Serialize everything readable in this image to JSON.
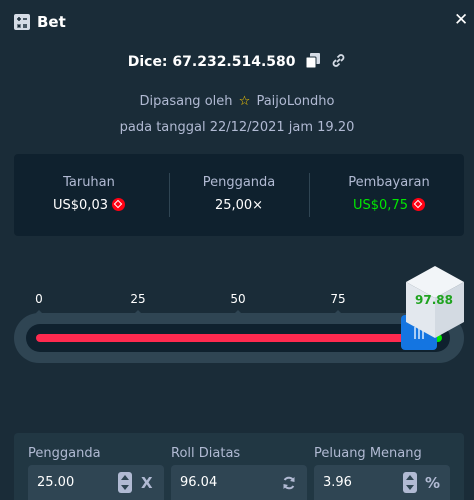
{
  "header": {
    "title": "Bet",
    "close": "✕"
  },
  "bet": {
    "dice_label": "Dice: 67.232.514.580",
    "placed_prefix": "Dipasang oleh",
    "player": "PaijoLondho",
    "date_line": "pada tanggal 22/12/2021 jam 19.20"
  },
  "stats": {
    "wager_label": "Taruhan",
    "wager_value": "US$0,03",
    "multiplier_label": "Pengganda",
    "multiplier_value": "25,00×",
    "payout_label": "Pembayaran",
    "payout_value": "US$0,75",
    "payout_color": "#00e701",
    "currency_icon": "tron-icon"
  },
  "slider": {
    "ticks": [
      "0",
      "25",
      "50",
      "75"
    ],
    "roll_over": 96.04,
    "result": "97.88",
    "lose_color": "#ff2a4f",
    "win_color": "#00e701",
    "handle_color": "#1475e1"
  },
  "fields": {
    "multiplier_label": "Pengganda",
    "multiplier_value": "25.00",
    "multiplier_suffix": "X",
    "roll_label": "Roll Diatas",
    "roll_value": "96.04",
    "chance_label": "Peluang Menang",
    "chance_value": "3.96",
    "chance_suffix": "%"
  }
}
